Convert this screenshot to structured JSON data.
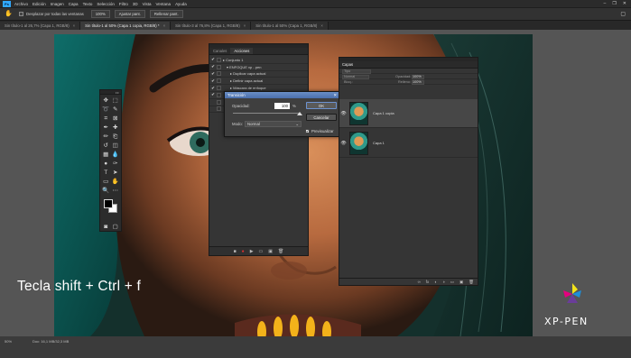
{
  "menubar": {
    "app_icon": "Ps",
    "items": [
      "Archivo",
      "Edición",
      "Imagen",
      "Capa",
      "Texto",
      "Selección",
      "Filtro",
      "3D",
      "Vista",
      "Ventana",
      "Ayuda"
    ],
    "window_controls": [
      "–",
      "❐",
      "✕"
    ]
  },
  "options_bar": {
    "tool_icon": "hand-icon",
    "checkbox_label": "Desplazar por todas las ventanas",
    "btn_zoom": "100%",
    "btn_fit": "Ajustar pant.",
    "btn_fill": "Rellenar pant."
  },
  "doc_tabs": [
    {
      "label": "Sin título-1 al 26,7% (Capa 1, RGB/8)",
      "active": false
    },
    {
      "label": "Sin título-1 al 50% (Capa 1 copia, RGB/8) *",
      "active": true
    },
    {
      "label": "Sin título-3 al 76,8% (Capa 1, RGB/8)",
      "active": false
    },
    {
      "label": "Sin título-1 al 50% (Capa 1, RGB/8)",
      "active": false
    }
  ],
  "actions_panel": {
    "tabs": [
      "Canales",
      "Acciones"
    ],
    "active_tab": "Acciones",
    "rows": [
      {
        "check": "✔",
        "indent": 0,
        "text": "▸ Conjunto 1"
      },
      {
        "check": "✔",
        "indent": 4,
        "text": "▾ ENFOQUE xp - pen"
      },
      {
        "check": "✔",
        "indent": 8,
        "text": "▸ Duplicar capa actual"
      },
      {
        "check": "✔",
        "indent": 8,
        "text": "▸ Definir capa actual"
      },
      {
        "check": "✔",
        "indent": 8,
        "text": "▸ Máscara de enfoque"
      },
      {
        "check": "✔",
        "indent": 8,
        "text": "▸ Transición"
      },
      {
        "check": "",
        "indent": 8,
        "text": ""
      },
      {
        "check": "",
        "indent": 8,
        "text": ""
      }
    ],
    "footer_icons": [
      "■",
      "●",
      "▶",
      "▭",
      "▣",
      "🗑"
    ]
  },
  "dialog": {
    "title": "Transición",
    "close": "✕",
    "opacity_label": "Opacidad:",
    "opacity_value": "100",
    "opacity_unit": "%",
    "opacity_level": 1.0,
    "mode_label": "Modo:",
    "mode_value": "Normal",
    "ok": "OK",
    "cancel": "Cancelar",
    "preview_label": "Previsualizar",
    "preview_checked": "✔"
  },
  "layers_panel": {
    "tab": "Capas",
    "kind_label": "Tipo",
    "opacity_label": "Opacidad:",
    "opacity_value": "100%",
    "fill_label": "Relleno:",
    "fill_value": "100%",
    "blend": "Normal",
    "lock_label": "Bloq.:",
    "layers": [
      {
        "name": "Capa 1 copia",
        "selected": true,
        "visible": "👁"
      },
      {
        "name": "Capa 1",
        "selected": false,
        "visible": "👁"
      }
    ],
    "footer_icons": [
      "∞",
      "fx",
      "◐",
      "◑",
      "▭",
      "▣",
      "🗑"
    ]
  },
  "statusbar": {
    "zoom": "50%",
    "doc": "Doc: 16,1 MB/32,3 MB"
  },
  "overlay": {
    "caption": "Tecla shift + Ctrl + f",
    "brand": "XP-PEN"
  },
  "colors": {
    "ps_blue": "#31a8ff",
    "record_red": "#e03030",
    "xp_yellow": "#f3e31a",
    "xp_magenta": "#e4007f",
    "xp_blue": "#1d8fd8",
    "xp_purple": "#6a3d9a"
  }
}
